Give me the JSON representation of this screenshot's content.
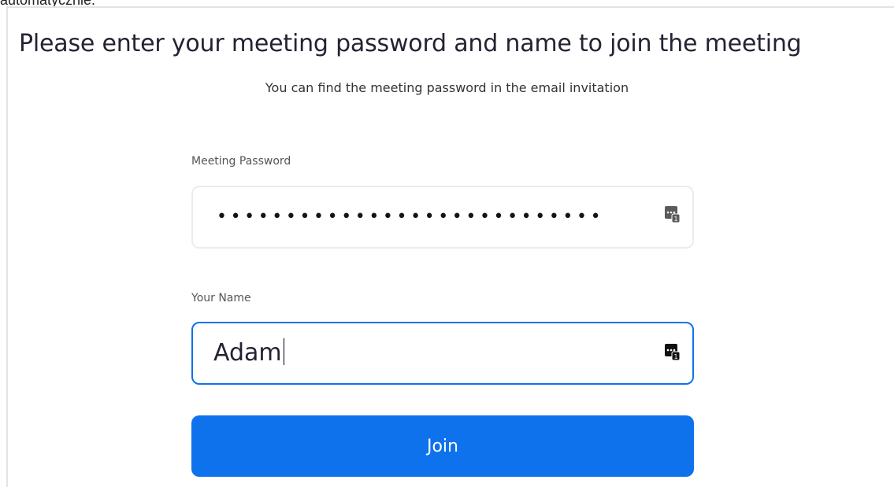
{
  "top_fragment": "automatycznie.",
  "title": "Please enter your meeting password and name to join the meeting",
  "subtitle": "You can find the meeting password in the email invitation",
  "password_field": {
    "label": "Meeting Password",
    "masked_value": "••••••••••••••••••••••••••••",
    "icon": "password-manager-icon"
  },
  "name_field": {
    "label": "Your Name",
    "value": "Adam",
    "icon": "password-manager-icon",
    "focused": true
  },
  "join_button": {
    "label": "Join"
  },
  "colors": {
    "accent": "#0e72ed",
    "title_text": "#232333",
    "input_border": "#ececec"
  }
}
